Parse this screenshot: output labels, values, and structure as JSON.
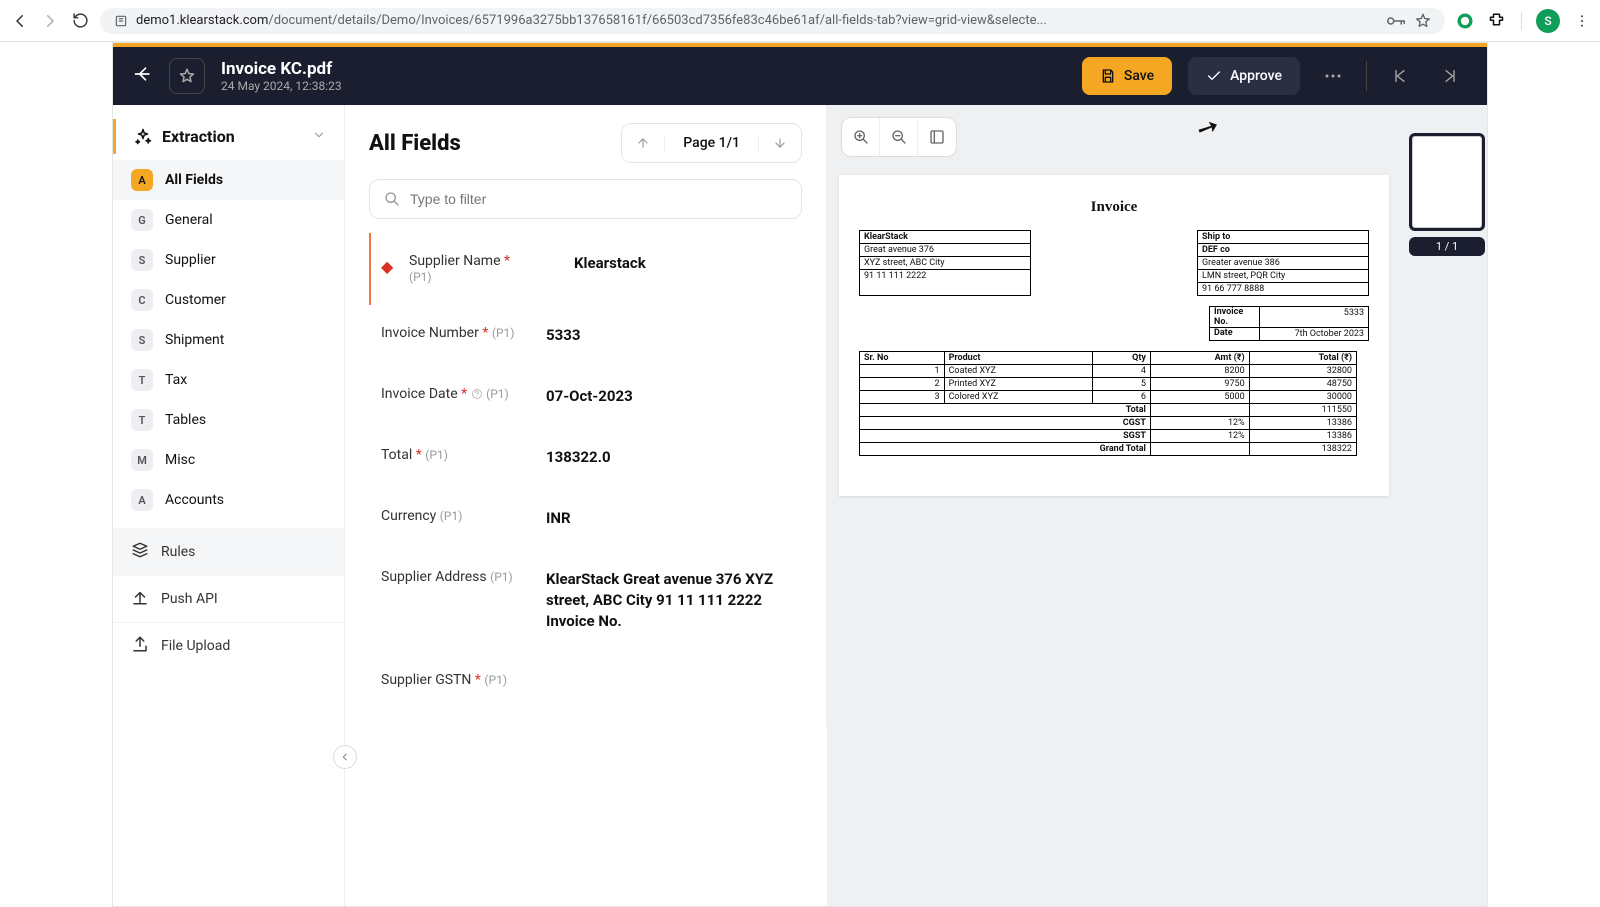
{
  "browser": {
    "url_domain": "demo1.klearstack.com",
    "url_path": "/document/details/Demo/Invoices/6571996a3275bb137658161f/66503cd7356fe83c46be61af/all-fields-tab?view=grid-view&selecte...",
    "avatar_initial": "S"
  },
  "header": {
    "title": "Invoice KC.pdf",
    "subtitle": "24 May 2024, 12:38:23",
    "save_label": "Save",
    "approve_label": "Approve"
  },
  "sidebar": {
    "section_label": "Extraction",
    "items": [
      {
        "badgechar": "A",
        "label": "All Fields",
        "active": true
      },
      {
        "badgechar": "G",
        "label": "General"
      },
      {
        "badgechar": "S",
        "label": "Supplier"
      },
      {
        "badgechar": "C",
        "label": "Customer"
      },
      {
        "badgechar": "S",
        "label": "Shipment"
      },
      {
        "badgechar": "T",
        "label": "Tax"
      },
      {
        "badgechar": "T",
        "label": "Tables"
      },
      {
        "badgechar": "M",
        "label": "Misc"
      },
      {
        "badgechar": "A",
        "label": "Accounts"
      }
    ],
    "tools": [
      {
        "label": "Rules",
        "key": "rules"
      },
      {
        "label": "Push API",
        "key": "pushapi"
      },
      {
        "label": "File Upload",
        "key": "fileupload"
      }
    ]
  },
  "center": {
    "heading": "All Fields",
    "page_indicator": "Page 1/1",
    "filter_placeholder": "Type to filter",
    "fields": [
      {
        "label": "Supplier Name",
        "required": true,
        "meta": "(P1)",
        "value": "Klearstack",
        "warning": true
      },
      {
        "label": "Invoice Number",
        "required": true,
        "meta": "(P1)",
        "value": "5333"
      },
      {
        "label": "Invoice Date",
        "required": true,
        "meta": "(P1)",
        "value": "07-Oct-2023",
        "help": true
      },
      {
        "label": "Total",
        "required": true,
        "meta": "(P1)",
        "value": "138322.0"
      },
      {
        "label": "Currency",
        "meta": "(P1)",
        "value": "INR"
      },
      {
        "label": "Supplier Address",
        "meta": "(P1)",
        "value": "KlearStack Great avenue 376 XYZ street, ABC City 91 11 111 2222 Invoice No."
      },
      {
        "label": "Supplier GSTN",
        "required": true,
        "meta": "(P1)",
        "value": ""
      }
    ]
  },
  "doc": {
    "title": "Invoice",
    "from": [
      "KlearStack",
      "Great avenue 376",
      "XYZ street, ABC City",
      "91 11 111 2222"
    ],
    "shipto_head": "Ship to",
    "shipto": [
      "DEF co",
      "Greater avenue 386",
      "LMN street, PQR City",
      "91 66 777 8888"
    ],
    "invno_label": "Invoice No.",
    "invno": "5333",
    "date_label": "Date",
    "date": "7th October 2023",
    "cols": [
      "Sr. No",
      "Product",
      "Qty",
      "Amt (₹)",
      "Total (₹)"
    ],
    "rows": [
      {
        "sr": "1",
        "prod": "Coated XYZ",
        "qty": "4",
        "amt": "8200",
        "total": "32800"
      },
      {
        "sr": "2",
        "prod": "Printed XYZ",
        "qty": "5",
        "amt": "9750",
        "total": "48750"
      },
      {
        "sr": "3",
        "prod": "Colored XYZ",
        "qty": "6",
        "amt": "5000",
        "total": "30000"
      }
    ],
    "summary": [
      {
        "label": "Total",
        "pct": "",
        "val": "111550"
      },
      {
        "label": "CGST",
        "pct": "12%",
        "val": "13386"
      },
      {
        "label": "SGST",
        "pct": "12%",
        "val": "13386"
      },
      {
        "label": "Grand Total",
        "pct": "",
        "val": "138322"
      }
    ]
  },
  "thumb": {
    "label": "1 / 1"
  }
}
